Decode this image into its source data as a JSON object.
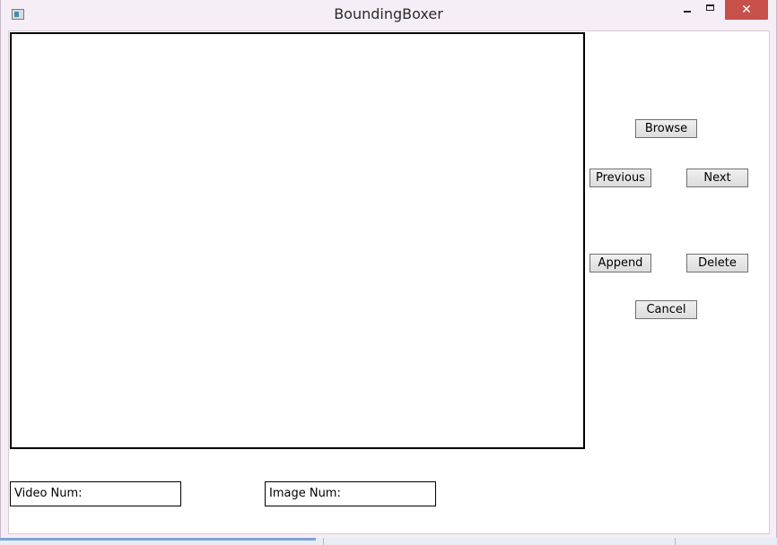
{
  "window": {
    "title": "BoundingBoxer",
    "close_glyph": "✕",
    "icons": {
      "app": "app-icon",
      "minimize": "minimize-icon",
      "maximize": "maximize-icon",
      "close": "close-icon"
    },
    "colors": {
      "close_button": "#c7504b",
      "frame": "#f6eef6"
    }
  },
  "controls": {
    "browse_label": "Browse",
    "previous_label": "Previous",
    "next_label": "Next",
    "append_label": "Append",
    "delete_label": "Delete",
    "cancel_label": "Cancel"
  },
  "status": {
    "video_num_label": "Video Num:",
    "image_num_label": "Image Num:"
  }
}
